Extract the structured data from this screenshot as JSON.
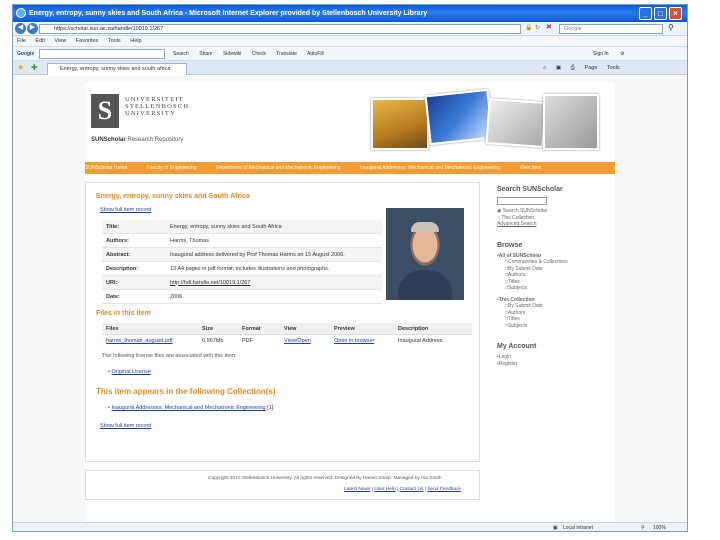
{
  "window": {
    "title": "Energy, entropy, sunny skies and South Africa - Microsoft Internet Explorer provided by Stellenbosch University Library",
    "minimize": "_",
    "maximize": "□",
    "close": "×"
  },
  "address_bar": {
    "url": "https://scholar.sun.ac.za/handle/10019.1/267",
    "search_placeholder": "Google"
  },
  "menu": [
    "File",
    "Edit",
    "View",
    "Favorites",
    "Tools",
    "Help"
  ],
  "toolbar": {
    "google_label": "Google",
    "items": [
      "Search",
      "Share",
      "Sidewiki",
      "Check",
      "Translate",
      "AutoFill"
    ],
    "right_items": [
      "Sign In",
      "⚙"
    ]
  },
  "tab": {
    "label": "Energy, entropy, sunny skies and south africa",
    "right_items": [
      "Page",
      "Tools"
    ]
  },
  "site": {
    "university_lines": [
      "UNIVERSITEIT",
      "STELLENBOSCH",
      "UNIVERSITY"
    ],
    "logo_letter": "S",
    "repo_brand": "SUNScholar",
    "repo_label": "Research Repository",
    "breadcrumbs": [
      "SUNScholar Home",
      "Faculty of Engineering",
      "Department of Mechanical and Mechatronic Engineering",
      "Inaugural Addresses: Mechanical and Mechatronic Engineering",
      "View Item"
    ]
  },
  "item": {
    "title": "Energy, entropy, sunny skies and South Africa",
    "show_full": "Show full item record",
    "metadata": [
      {
        "key": "Title:",
        "value": "Energy, entropy, sunny skies and South Africa"
      },
      {
        "key": "Authors:",
        "value": "Harms, Thomas"
      },
      {
        "key": "Abstract:",
        "value": "Inaugural address delivered by Prof Thomas Harms on 15 August 2006."
      },
      {
        "key": "Description:",
        "value": "13 A4 pages in pdf format; includes illustrations and photographs."
      },
      {
        "key": "URI:",
        "value": "http://hdl.handle.net/10019.1/267"
      },
      {
        "key": "Date:",
        "value": "2006"
      }
    ],
    "files_heading": "Files in this item",
    "files_columns": [
      "Files",
      "Size",
      "Format",
      "View",
      "Preview",
      "Description"
    ],
    "files": [
      {
        "file": "harms_thomas_augustt.pdf",
        "size": "6.567Mb",
        "format": "PDF",
        "view": "View/Open",
        "preview": "Open in browser",
        "description": "Inaugural Address"
      }
    ],
    "license_text": "The following license files are associated with this item:",
    "license_link": "Original License",
    "collections_heading": "This item appears in the following Collection(s)",
    "collection_link": "Inaugural Addresses: Mechanical and Mechatronic Engineering",
    "collection_count": "[1]",
    "show_full_bottom": "Show full item record"
  },
  "sidebar": {
    "search_heading": "Search SUNScholar",
    "search_opts": [
      "Search SUNScholar",
      "This Collection"
    ],
    "advanced": "Advanced Search",
    "browse_heading": "Browse",
    "all_heading": "All of SUNScholar",
    "all_items": [
      "Communities & Collections",
      "By Submit Date",
      "Authors",
      "Titles",
      "Subjects"
    ],
    "coll_heading": "This Collection",
    "coll_items": [
      "By Submit Date",
      "Authors",
      "Titles",
      "Subjects"
    ],
    "account_heading": "My Account",
    "account_items": [
      "Login",
      "Register"
    ]
  },
  "footer": {
    "copyright": "Copyright 2010 Stellenbosch University. All rights reserved. Designed by Hanno Stoop. Managed by Ina Smith",
    "links": [
      "Latest News",
      "User Help",
      "Contact Us",
      "Send Feedback"
    ]
  },
  "statusbar": {
    "zone": "Local intranet",
    "zoom": "100%"
  },
  "colors": {
    "accent_orange": "#f39c33",
    "link_blue": "#1f3fa8",
    "heading_orange": "#e08a1e",
    "titlebar_blue": "#0a5ad8"
  }
}
